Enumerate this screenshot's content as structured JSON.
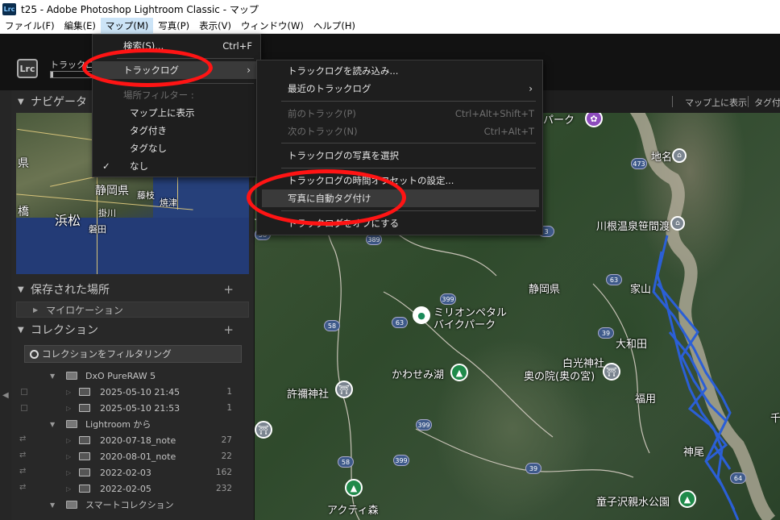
{
  "window": {
    "app_icon": "Lrc",
    "title": "t25 - Adobe Photoshop Lightroom Classic - マップ"
  },
  "menubar": [
    "ファイル(F)",
    "編集(E)",
    "マップ(M)",
    "写真(P)",
    "表示(V)",
    "ウィンドウ(W)",
    "ヘルプ(H)"
  ],
  "header": {
    "logo": "Lrc",
    "progress_label": "トラックログ",
    "progress_fraction": 0.05
  },
  "left_panel": {
    "navigator_title": "ナビゲータ",
    "navigator_labels": {
      "ken": "県",
      "shizuoka": "静岡県",
      "fujieda": "藤枝",
      "yaizu": "焼津",
      "kakegawa": "掛川",
      "hamamatsu": "浜松",
      "iwata": "磐田",
      "hashi": "橋"
    },
    "saved_places_title": "保存された場所",
    "my_locations": "マイロケーション",
    "collections_title": "コレクション",
    "filter_placeholder": "コレクションをフィルタリング",
    "tree": [
      {
        "type": "set",
        "name": "DxO PureRAW 5",
        "count": ""
      },
      {
        "type": "coll",
        "name": "2025-05-10 21:45",
        "count": "1",
        "mark": "check"
      },
      {
        "type": "coll",
        "name": "2025-05-10 21:53",
        "count": "1",
        "mark": "check"
      },
      {
        "type": "set",
        "name": "Lightroom から",
        "count": ""
      },
      {
        "type": "coll",
        "name": "2020-07-18_note",
        "count": "27",
        "mark": "sync"
      },
      {
        "type": "coll",
        "name": "2020-08-01_note",
        "count": "22",
        "mark": "sync"
      },
      {
        "type": "coll",
        "name": "2022-02-03",
        "count": "162",
        "mark": "sync"
      },
      {
        "type": "coll",
        "name": "2022-02-05",
        "count": "232",
        "mark": "sync"
      },
      {
        "type": "set",
        "name": "スマートコレクション",
        "count": ""
      }
    ]
  },
  "map_toolbar": {
    "show_on_map": "マップ上に表示",
    "tagged": "タグ付き"
  },
  "map": {
    "labels": {
      "park": "パーク",
      "chimei": "地名",
      "kawane": "川根温泉笹間渡",
      "shizuoka": "静岡県",
      "ieyama": "家山",
      "million": "ミリオンペタル",
      "bikepark": "バイクパーク",
      "owada": "大和田",
      "shiko": "白光神社",
      "okunoin": "奥の院(奥の宮)",
      "kawasemi": "かわせみ湖",
      "kyona": "許禰神社",
      "fukuyo": "福用",
      "kamio": "神尾",
      "doji": "童子沢親水公園",
      "akuti": "アクティ森",
      "chi": "千"
    },
    "roads": [
      "473",
      "389",
      "399",
      "63",
      "58",
      "39",
      "63",
      "399",
      "399",
      "58",
      "39",
      "64",
      "3"
    ]
  },
  "map_menu": {
    "search": "検索(S)...",
    "search_shortcut": "Ctrl+F",
    "tracklog": "トラックログ",
    "location_filter": "場所フィルター :",
    "filters": [
      "マップ上に表示",
      "タグ付き",
      "タグなし",
      "なし"
    ],
    "checked": "なし"
  },
  "tracklog_menu": {
    "items": [
      {
        "label": "トラックログを読み込み...",
        "shortcut": "",
        "disabled": false
      },
      {
        "label": "最近のトラックログ",
        "shortcut": "",
        "disabled": false,
        "submenu": true
      },
      {
        "label": "前のトラック(P)",
        "shortcut": "Ctrl+Alt+Shift+T",
        "disabled": true
      },
      {
        "label": "次のトラック(N)",
        "shortcut": "Ctrl+Alt+T",
        "disabled": true
      },
      {
        "label": "トラックログの写真を選択",
        "shortcut": "",
        "disabled": false
      },
      {
        "label": "トラックログの時間オフセットの設定...",
        "shortcut": "",
        "disabled": false
      },
      {
        "label": "写真に自動タグ付け",
        "shortcut": "",
        "disabled": false,
        "highlighted": true
      },
      {
        "label": "トラックログをオフにする",
        "shortcut": "",
        "disabled": false
      }
    ]
  },
  "colors": {
    "annotation": "#ff1414",
    "track": "#2b5fd6",
    "menu_bg": "#1e1e1e"
  }
}
